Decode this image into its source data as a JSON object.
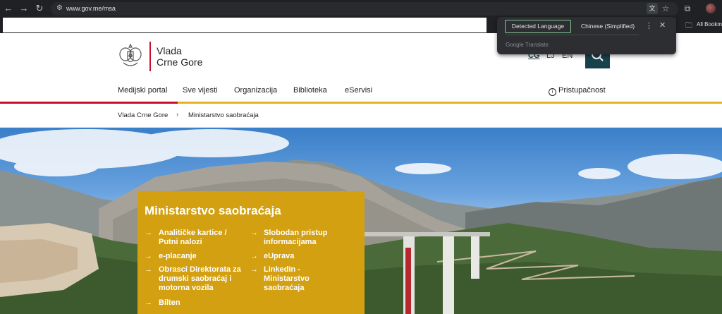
{
  "browser": {
    "url": "www.gov.me/msa",
    "bookmarks_folder_label": "All Bookmarks"
  },
  "translate_popup": {
    "detected_label": "Detected Language",
    "target_label": "Chinese (Simplified)",
    "brand": "Google Translate"
  },
  "header": {
    "logo_line1": "Vlada",
    "logo_line2": "Crne Gore",
    "languages": [
      "CG",
      "LJ",
      "EN"
    ],
    "nav": [
      "Medijski portal",
      "Sve vijesti",
      "Organizacija",
      "Biblioteka",
      "eServisi"
    ],
    "accessibility_label": "Pristupačnost"
  },
  "breadcrumb": {
    "root": "Vlada Crne Gore",
    "current": "Ministarstvo saobraćaja"
  },
  "hero": {
    "title": "Ministarstvo saobraćaja",
    "links_left": [
      "Analitičke kartice / Putni nalozi",
      "e-placanje",
      "Obrasci Direktorata za drumski saobraćaj i motorna vozila",
      "Bilten"
    ],
    "links_right": [
      "Slobodan pristup informacijama",
      "eUprava",
      "LinkedIn - Ministarstvo saobraćaja"
    ]
  },
  "colors": {
    "brand_red": "#c8102e",
    "brand_gold": "#e6b422",
    "panel_gold": "#d3a012",
    "search_teal": "#17414b"
  }
}
